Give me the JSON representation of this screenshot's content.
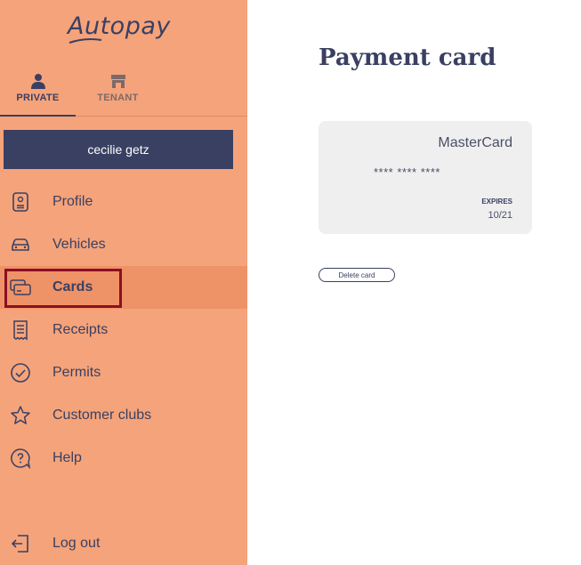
{
  "app": {
    "logo": "Autopay"
  },
  "tabs": [
    {
      "label": "PRIVATE",
      "icon": "person-icon",
      "active": true
    },
    {
      "label": "TENANT",
      "icon": "store-icon",
      "active": false
    }
  ],
  "user": {
    "name": "cecilie getz"
  },
  "nav": [
    {
      "label": "Profile",
      "icon": "id-card-icon",
      "active": false
    },
    {
      "label": "Vehicles",
      "icon": "car-icon",
      "active": false
    },
    {
      "label": "Cards",
      "icon": "credit-card-icon",
      "active": true
    },
    {
      "label": "Receipts",
      "icon": "receipt-icon",
      "active": false
    },
    {
      "label": "Permits",
      "icon": "check-circle-icon",
      "active": false
    },
    {
      "label": "Customer clubs",
      "icon": "star-icon",
      "active": false
    },
    {
      "label": "Help",
      "icon": "help-icon",
      "active": false
    }
  ],
  "logout": {
    "label": "Log out",
    "icon": "logout-icon"
  },
  "main": {
    "title": "Payment card",
    "card": {
      "brand": "MasterCard",
      "number": "**** **** ****",
      "expires_label": "EXPIRES",
      "expires": "10/21"
    },
    "delete_label": "Delete card"
  },
  "colors": {
    "sidebar": "#f5a37a",
    "active_item": "#ee9267",
    "navy": "#3a4062",
    "highlight": "#8b0f23"
  }
}
